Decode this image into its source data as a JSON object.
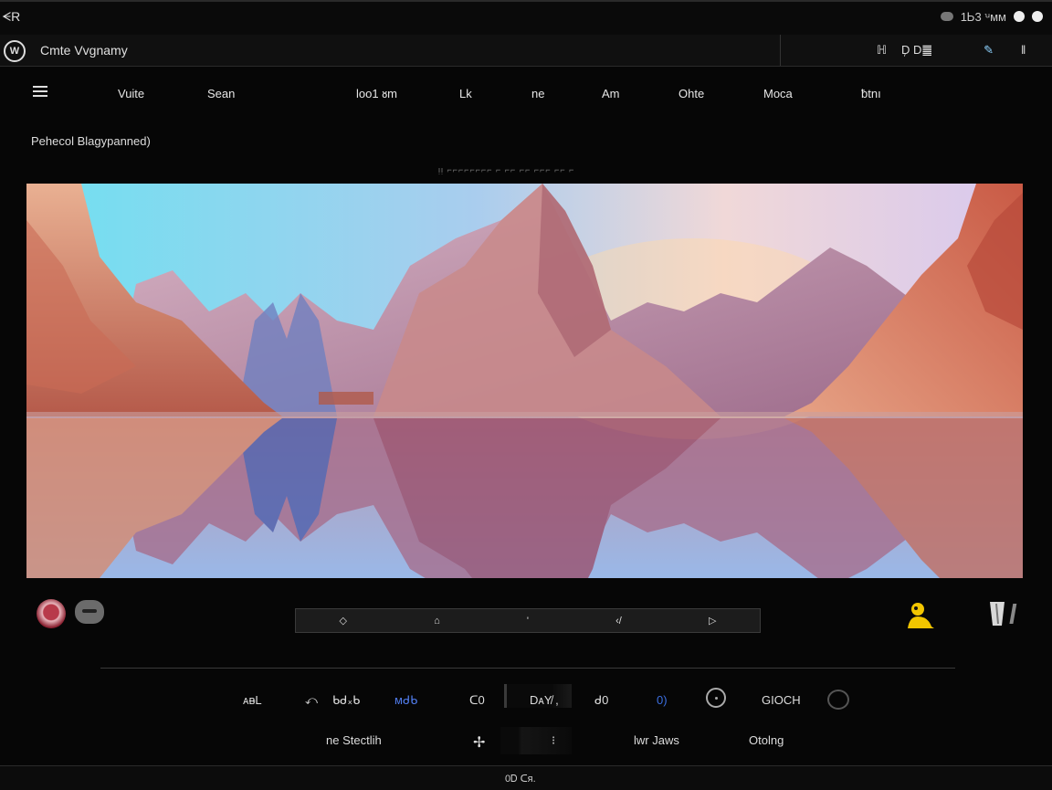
{
  "system_bar": {
    "label": "ᗕR",
    "status_text": "1Ꮟ3 ꭟᴍᴍ"
  },
  "window": {
    "logo_text": "W",
    "title": "Cmte Vvgnamy",
    "tools": [
      "ℍ",
      "D᷊ D䷀",
      "⁄"
    ]
  },
  "menu": {
    "items": [
      "Vuite",
      "Sean",
      "loo1 ᴕm",
      "Lk",
      "ne",
      "Am",
      "Ohte",
      "Moca",
      "ƀtnı"
    ]
  },
  "breadcrumb": "Pehecol Blagypanned)",
  "caption": "ᴉᴉ ⌐⌐⌐⌐⌐⌐⌐⌐ ⌐ ⌐⌐ ⌐⌐ ⌐⌐⌐ ⌐⌐ ⌐",
  "scrubber": {
    "marks": [
      "◇",
      "⌂",
      "'",
      "‹/",
      "▷"
    ]
  },
  "controls_row1": {
    "items": [
      "ᴀᴃL",
      "⤺",
      "ᑲᑯ᙮ᑲ",
      "ᴍᑯᑲ",
      "ᑕ0",
      "DᴀY̸ ,",
      "ᑯ0",
      "0)",
      "GIOCH"
    ]
  },
  "controls_row2": {
    "items": [
      "ne Stectlih",
      "✢",
      "⁝",
      "lwr Jaws",
      "Otolng"
    ]
  },
  "footer": {
    "text": "0Ꭰ ᑕᴙ."
  },
  "icons": {
    "user": "user-icon",
    "trash": "trash-icon",
    "menu": "hamburger-icon",
    "knob": "knob-icon",
    "dial": "dial-icon"
  },
  "colors": {
    "accent_yellow": "#f2c500",
    "accent_blue": "#3b6fe0",
    "background": "#060606"
  }
}
